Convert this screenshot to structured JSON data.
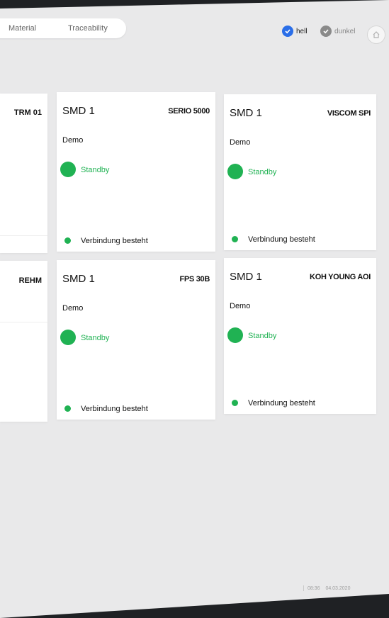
{
  "nav": {
    "material": "Material",
    "traceability": "Traceability"
  },
  "theme": {
    "light": "hell",
    "dark": "dunkel",
    "accent": "#2a6ee8"
  },
  "status_color": "#20b253",
  "partial_cards": [
    {
      "model": "TRM 01"
    },
    {
      "model": "REHM"
    }
  ],
  "cards": [
    {
      "title": "SMD 1",
      "model": "SERIO 5000",
      "subtitle": "Demo",
      "status": "Standby",
      "connection": "Verbindung besteht"
    },
    {
      "title": "SMD 1",
      "model": "VISCOM SPI",
      "subtitle": "Demo",
      "status": "Standby",
      "connection": "Verbindung besteht"
    },
    {
      "title": "SMD 1",
      "model": "FPS 30B",
      "subtitle": "Demo",
      "status": "Standby",
      "connection": "Verbindung besteht"
    },
    {
      "title": "SMD 1",
      "model": "KOH YOUNG AOI",
      "subtitle": "Demo",
      "status": "Standby",
      "connection": "Verbindung besteht"
    }
  ],
  "footer": {
    "time": "08:36",
    "date": "04.03.2020"
  }
}
